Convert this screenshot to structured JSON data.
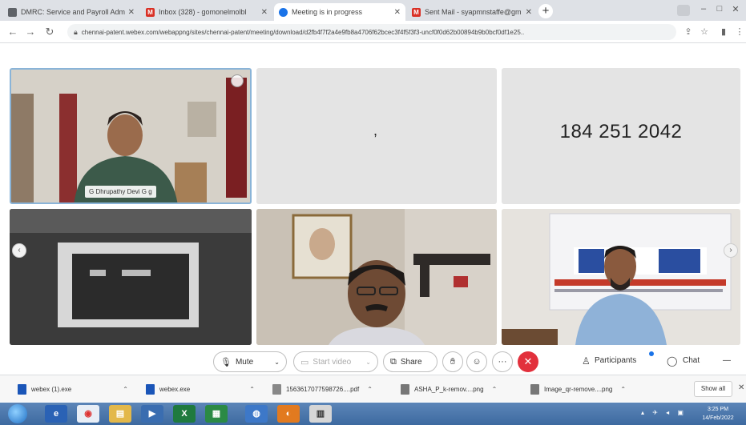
{
  "browser": {
    "tabs": [
      {
        "label": "DMRC: Service and Payroll Adm",
        "icon": "generic-favicon",
        "color": "#5f6368"
      },
      {
        "label": "Inbox (328) - gomonelmolbl",
        "icon": "gmail-favicon",
        "color": "#d93025"
      },
      {
        "label": "Meeting is in progress",
        "icon": "webex-favicon",
        "color": "#1a73e8"
      },
      {
        "label": "Sent Mail - syapmnstaffe@gm",
        "icon": "gmail-favicon",
        "color": "#d93025"
      }
    ],
    "new_tab": "+",
    "url": "chennai-patent.webex.com/webappng/sites/chennai-patent/meeting/download/d2fb4f7f2a4e9fb8a4706f62bcec3f4f5f3f3-uncf0f0d62b00894b9b0bcf0df1e25.."
  },
  "meeting": {
    "participants": [
      {
        "name": "G Dhrupathy Devi G g",
        "tile": "video"
      },
      {
        "text": ",",
        "tile": "blank"
      },
      {
        "text": "184 251 2042",
        "tile": "blank"
      }
    ],
    "nav_left": "‹",
    "nav_right": "›"
  },
  "controls": {
    "mute": "Mute",
    "start_video": "Start video",
    "share": "Share",
    "more": "···",
    "end": "✕",
    "participants": "Participants",
    "chat": "Chat",
    "more_right": "—"
  },
  "downloads": {
    "items": [
      {
        "name": "webex (1).exe",
        "type": "exe"
      },
      {
        "name": "webex.exe",
        "type": "exe"
      },
      {
        "name": "1563617077598726....pdf",
        "type": "pdf"
      },
      {
        "name": "ASHA_P_k-remov....png",
        "type": "img"
      },
      {
        "name": "Image_qr-remove....png",
        "type": "img"
      }
    ],
    "show_all": "Show all"
  },
  "taskbar": {
    "clock_time": "3:25 PM",
    "clock_date": "14/Feb/2022"
  }
}
